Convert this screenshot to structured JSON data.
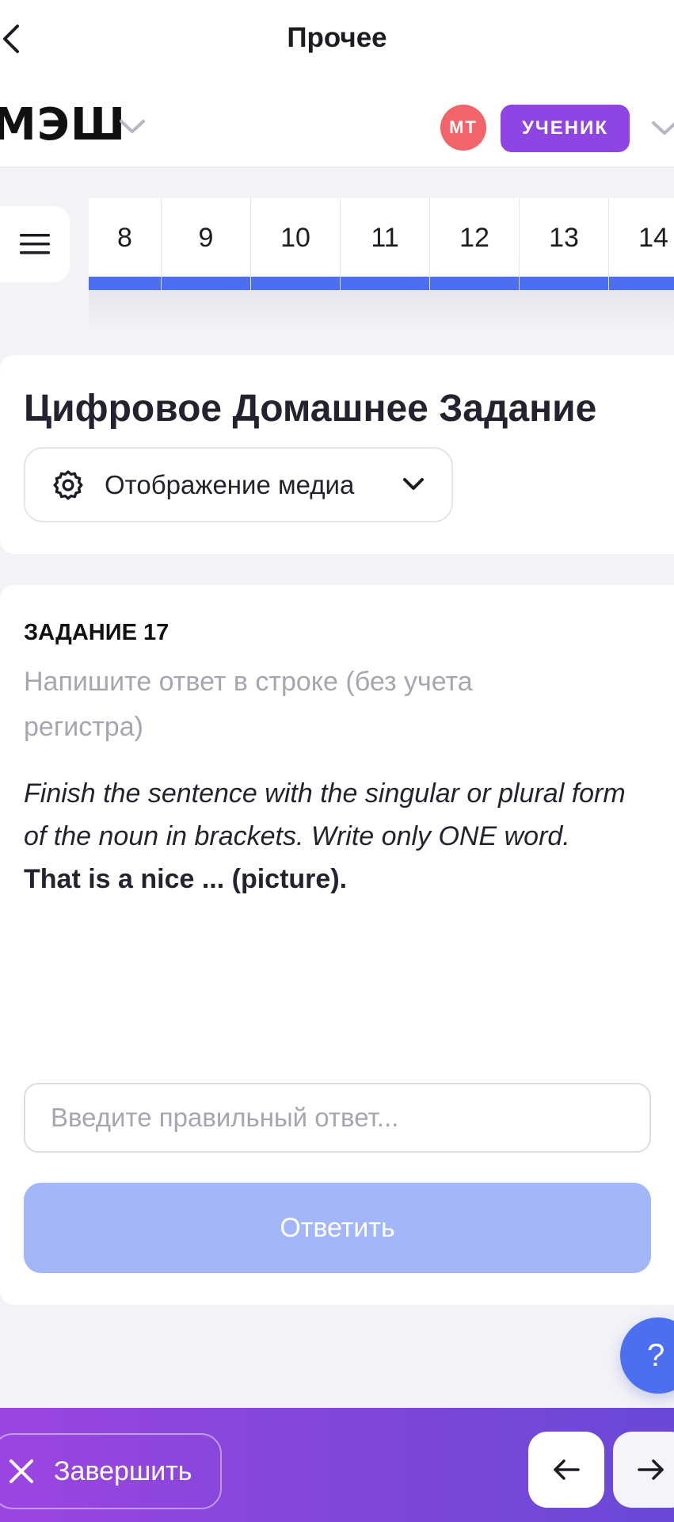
{
  "header": {
    "title": "Прочее",
    "logo": "МЭШ",
    "avatar_initials": "МТ",
    "role": "УЧЕНИК"
  },
  "tabs": [
    "8",
    "9",
    "10",
    "11",
    "12",
    "13",
    "14"
  ],
  "media_card": {
    "title": "Цифровое Домашнее Задание",
    "media_toggle_label": "Отображение медиа"
  },
  "task": {
    "number_label": "ЗАДАНИЕ 17",
    "hint": "Напишите ответ в строке (без учета регистра)",
    "instruction": "Finish the sentence with the singular or plural form of the noun in brackets. Write only ONE word.",
    "sentence": "That is a nice ... (picture).",
    "answer_placeholder": "Введите правильный ответ...",
    "submit_label": "Ответить"
  },
  "help": {
    "label": "?"
  },
  "footer": {
    "finish_label": "Завершить"
  },
  "colors": {
    "accent": "#4c6ff0",
    "role_badge": "#8f45e4",
    "avatar": "#f2646a",
    "submit_disabled": "#a3b6f9"
  }
}
